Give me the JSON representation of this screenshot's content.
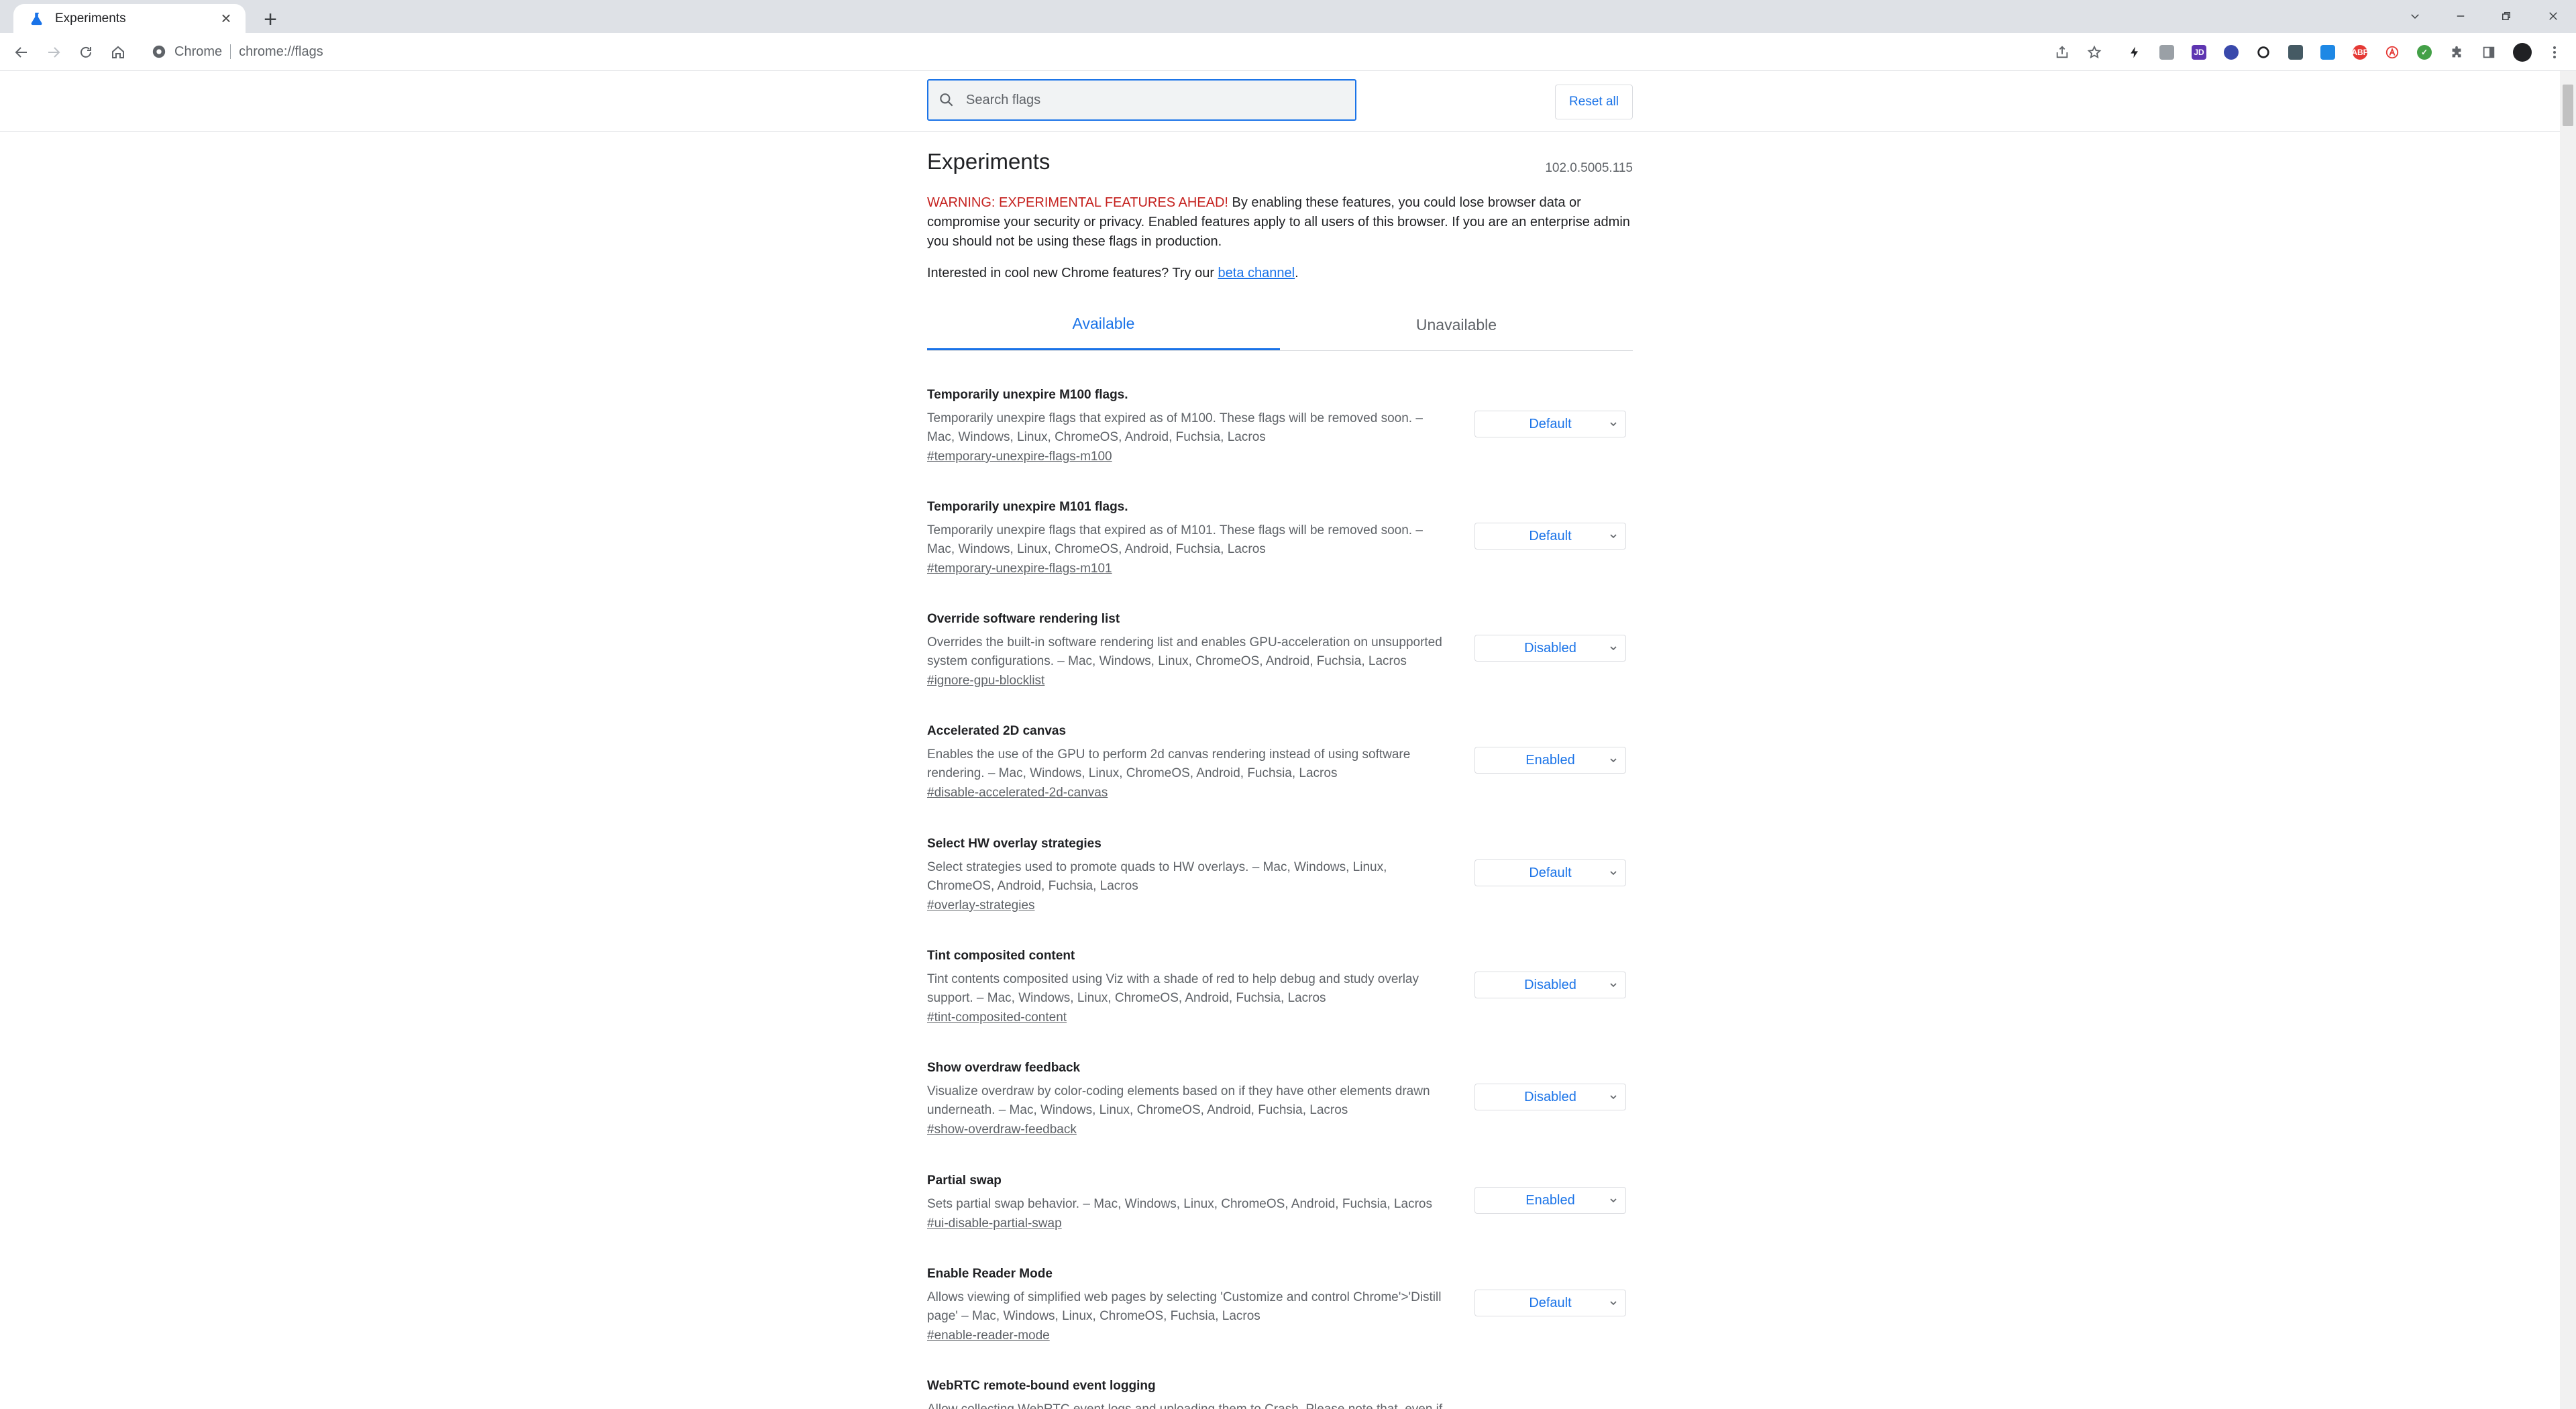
{
  "browser": {
    "tab_title": "Experiments",
    "site_label": "Chrome",
    "url": "chrome://flags"
  },
  "header": {
    "search_placeholder": "Search flags",
    "reset_label": "Reset all"
  },
  "page": {
    "title": "Experiments",
    "version": "102.0.5005.115",
    "warning_prefix": "WARNING: EXPERIMENTAL FEATURES AHEAD!",
    "warning_body": " By enabling these features, you could lose browser data or compromise your security or privacy. Enabled features apply to all users of this browser. If you are an enterprise admin you should not be using these flags in production.",
    "beta_prefix": "Interested in cool new Chrome features? Try our ",
    "beta_link": "beta channel",
    "beta_suffix": ".",
    "tabs": [
      "Available",
      "Unavailable"
    ]
  },
  "experiments": [
    {
      "name": "Temporarily unexpire M100 flags.",
      "desc": "Temporarily unexpire flags that expired as of M100. These flags will be removed soon. – Mac, Windows, Linux, ChromeOS, Android, Fuchsia, Lacros",
      "link": "#temporary-unexpire-flags-m100",
      "value": "Default"
    },
    {
      "name": "Temporarily unexpire M101 flags.",
      "desc": "Temporarily unexpire flags that expired as of M101. These flags will be removed soon. – Mac, Windows, Linux, ChromeOS, Android, Fuchsia, Lacros",
      "link": "#temporary-unexpire-flags-m101",
      "value": "Default"
    },
    {
      "name": "Override software rendering list",
      "desc": "Overrides the built-in software rendering list and enables GPU-acceleration on unsupported system configurations. – Mac, Windows, Linux, ChromeOS, Android, Fuchsia, Lacros",
      "link": "#ignore-gpu-blocklist",
      "value": "Disabled"
    },
    {
      "name": "Accelerated 2D canvas",
      "desc": "Enables the use of the GPU to perform 2d canvas rendering instead of using software rendering. – Mac, Windows, Linux, ChromeOS, Android, Fuchsia, Lacros",
      "link": "#disable-accelerated-2d-canvas",
      "value": "Enabled"
    },
    {
      "name": "Select HW overlay strategies",
      "desc": "Select strategies used to promote quads to HW overlays. – Mac, Windows, Linux, ChromeOS, Android, Fuchsia, Lacros",
      "link": "#overlay-strategies",
      "value": "Default"
    },
    {
      "name": "Tint composited content",
      "desc": "Tint contents composited using Viz with a shade of red to help debug and study overlay support. – Mac, Windows, Linux, ChromeOS, Android, Fuchsia, Lacros",
      "link": "#tint-composited-content",
      "value": "Disabled"
    },
    {
      "name": "Show overdraw feedback",
      "desc": "Visualize overdraw by color-coding elements based on if they have other elements drawn underneath. – Mac, Windows, Linux, ChromeOS, Android, Fuchsia, Lacros",
      "link": "#show-overdraw-feedback",
      "value": "Disabled"
    },
    {
      "name": "Partial swap",
      "desc": "Sets partial swap behavior. – Mac, Windows, Linux, ChromeOS, Android, Fuchsia, Lacros",
      "link": "#ui-disable-partial-swap",
      "value": "Enabled"
    },
    {
      "name": "Enable Reader Mode",
      "desc": "Allows viewing of simplified web pages by selecting 'Customize and control Chrome'>'Distill page' – Mac, Windows, Linux, ChromeOS, Fuchsia, Lacros",
      "link": "#enable-reader-mode",
      "value": "Default"
    },
    {
      "name": "WebRTC remote-bound event logging",
      "desc": "Allow collecting WebRTC event logs and uploading them to Crash. Please note that, even if",
      "link": "",
      "value": ""
    }
  ],
  "colors": {
    "accent": "#1a73e8",
    "warning": "#c5221f",
    "tabstrip": "#dee1e6"
  },
  "icons": [
    "flask-icon",
    "close-icon",
    "plus-icon",
    "back-arrow-icon",
    "forward-arrow-icon",
    "reload-icon",
    "home-icon",
    "chrome-logo-icon",
    "search-icon",
    "share-icon",
    "star-icon",
    "puzzle-icon",
    "side-panel-icon",
    "kebab-menu-icon"
  ]
}
